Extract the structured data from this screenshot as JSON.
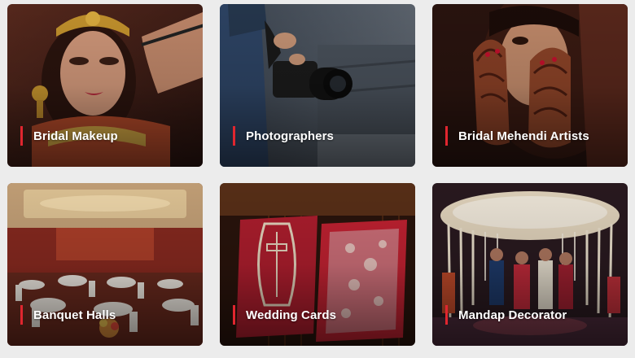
{
  "categories": [
    {
      "label": "Bridal Makeup"
    },
    {
      "label": "Photographers"
    },
    {
      "label": "Bridal Mehendi Artists"
    },
    {
      "label": "Banquet Halls"
    },
    {
      "label": "Wedding Cards"
    },
    {
      "label": "Mandap Decorator"
    }
  ],
  "colors": {
    "accent_bar": "#e0262f",
    "page_background": "#ececec",
    "label_text": "#ffffff"
  }
}
